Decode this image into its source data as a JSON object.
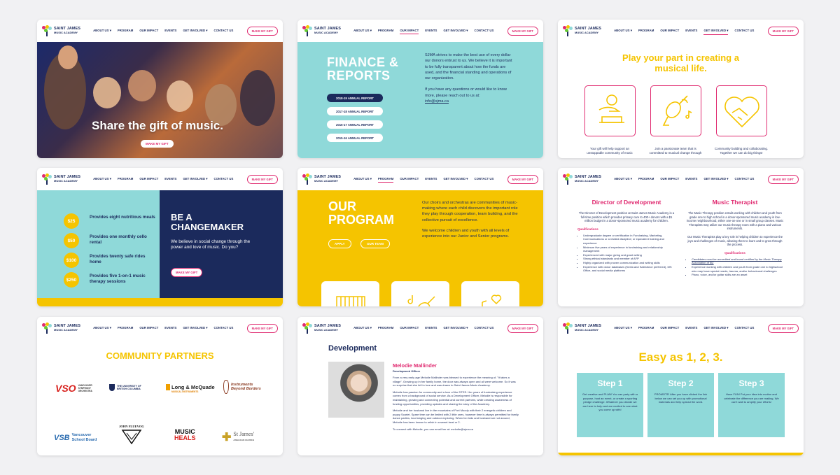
{
  "nav": {
    "logo_line1": "SAINT JAMES",
    "logo_line2": "MUSIC ACADEMY",
    "items": [
      "ABOUT US ▾",
      "PROGRAM",
      "OUR IMPACT",
      "EVENTS",
      "GET INVOLVED ▾",
      "CONTACT US"
    ],
    "gift": "MAKE MY GIFT"
  },
  "hero": {
    "title": "Share the gift of music.",
    "button": "MAKE MY GIFT"
  },
  "finance": {
    "title_line1": "FINANCE &",
    "title_line2": "REPORTS",
    "para1": "SJMA strives to make the best use of every dollar our donors entrust to us. We believe it is important to be fully transparent about how the funds are used, and the financial standing and operations of our organization.",
    "para2": "If you have any questions or would like to know more, please reach out to us at:",
    "email": "info@sjma.ca",
    "reports": [
      "2018-19 ANNUAL REPORT",
      "2017-18 ANNUAL REPORT",
      "2016-17 ANNUAL REPORT",
      "2015-16 ANNUAL REPORT"
    ]
  },
  "play": {
    "title_line1": "Play your part in creating a",
    "title_line2": "musical life.",
    "captions": [
      "Your gift will help support an unstoppable community of music",
      "Join a passionate team that is committed to musical change through",
      "Community building and collaborating. Together we can do big things!"
    ]
  },
  "change": {
    "amounts": [
      "$25",
      "$50",
      "$100",
      "$250"
    ],
    "labels": [
      "Provides eight nutritious meals",
      "Provides one monthly cello rental",
      "Provides twenty safe rides home",
      "Provides five 1-on-1 music therapy sessions"
    ],
    "title_line1": "BE A",
    "title_line2": "CHANGEMAKER",
    "text": "We believe in social change through the power and love of music. Do you?",
    "button": "MAKE MY GIFT"
  },
  "program": {
    "title_line1": "OUR",
    "title_line2": "PROGRAM",
    "para1": "Our choirs and orchestras are communities of music-making where each child discovers the important role they play through cooperation, team building, and the collective pursuit of excellence.",
    "para2": "We welcome children and youth with all levels of experience into our Junior and Senior programs.",
    "btn_apply": "APPLY",
    "btn_team": "OUR TEAM"
  },
  "jobs": {
    "left": {
      "title": "Director of Development",
      "intro": "The Director of Development position at Saint James Music Academy is a full-time position which provides primary care to 400+ donors with a $1 million budget in a donor-sponsored music academy for children.",
      "qual_heading": "Qualifications",
      "quals": [
        "Undergraduate degree or certification in Fundraising, Marketing, Communications or a related discipline; or equivalent training and experience",
        "Minimum five years of experience in fundraising and relationship management",
        "Experienced with major giving and grant writing",
        "Strong ethical standards and member of AFP",
        "Highly organized with proven communication and writing skills",
        "Experience with donor databases (Keela and Salesforce preferred), MS Office, and social media platforms"
      ]
    },
    "right": {
      "title": "Music Therapist",
      "intro": "The Music Therapy position entails working with children and youth from grade one to high school in a donor-sponsored music academy in low-income neighbourhood, either one-on-one or in small group classes. Music Therapists may utilize our music therapy room with a piano and various instruments.",
      "intro2": "Our Music Therapists play a key role in helping children to experience the joys and challenges of music, allowing them to learn and to grow through the process.",
      "qual_heading": "Qualifications",
      "quals": [
        "Candidates must be accredited and board certified by the Music Therapy Association of BC",
        "Experience working with children and youth from grade one to highschool who may have special needs, trauma, and/or behavioural challenges",
        "Piano, voice, and/or guitar skills are an asset"
      ]
    }
  },
  "partners": {
    "title": "COMMUNITY PARTNERS",
    "vso": "VSO",
    "vso_sub": "VANCOUVER SYMPHONY ORCHESTRA",
    "ubc": "THE UNIVERSITY OF BRITISH COLUMBIA",
    "lm": "Long & McQuade",
    "lm_sub": "MUSICAL INSTRUMENTS",
    "ibb_line1": "Instruments",
    "ibb_line2": "Beyond Borders",
    "vsb_mark": "VSB",
    "vsb_line1": "Vancouver",
    "vsb_line2": "School Board",
    "fluevog": "JOHN FLUEVOG",
    "mh_line1": "MUSIC",
    "mh_line2": "HEALS",
    "sj": "St James'",
    "sj_sub": "ANGLICAN CHURCH"
  },
  "dev": {
    "title": "Development",
    "name": "Melodie Mallinder",
    "role": "Development Officer",
    "paras": [
      "From a very early age Melodie Mallinder was blessed to experience the meaning of, \"it takes a village\". Growing up in her family home, the door was always open and all were welcome. So it was no surprise that she fell in love and was drawn to Saint James Music Academy.",
      "Melodie has passion for community and a love of the DTES. Her years of fundraising experience comes from a background of social service. As a Development Officer, Melodie is responsible for maintaining, growing and connecting potential and current partners, while creating awareness of funding opportunities, providing updates and sharing the story of the Academy.",
      "Melodie and her husband live in the mountains of Port Moody with their 2 energetic children and puppy Scarlet. Spare time can be limited with 2 little ones, however time is always permitted for family dance parties, loud singing and outdoor exploring. When her kids and husband are not around, Melodie has been known to relish in a sweet treat or 2.",
      "To connect with Melodie, you can email her at: melodie@sjma.ca"
    ]
  },
  "easy": {
    "title": "Easy as 1, 2, 3.",
    "steps": [
      {
        "title": "Step 1",
        "text": "Get creative and PLAN! You can party with a purpose, host an event, or create a sporting pledge challenge. Whatever you decide we are here to help and are excited to see what you come up with!"
      },
      {
        "title": "Step 2",
        "text": "PROMOTE! After you have clicked the link below we can set you up with promotional materials and help spread the word."
      },
      {
        "title": "Step 3",
        "text": "Have FUN! Put your idea into motion and celebrate the difference you are making. We can't wait to amplify your efforts!"
      }
    ]
  },
  "colors": {
    "navy": "#1b2a5c",
    "pink": "#e02a70",
    "teal": "#8fd9d9",
    "yellow": "#f5c400"
  }
}
